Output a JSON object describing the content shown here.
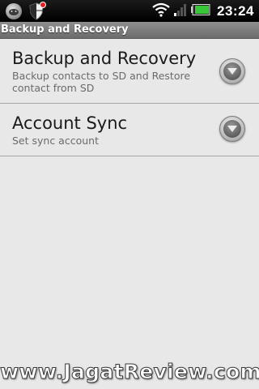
{
  "status_bar": {
    "time": "23:24",
    "icons": [
      "android-notification-icon",
      "shield-alert-icon",
      "wifi-icon",
      "signal-icon",
      "battery-icon"
    ]
  },
  "header": {
    "title": "Backup and Recovery"
  },
  "list": {
    "items": [
      {
        "title": "Backup and Recovery",
        "summary": "Backup contacts to SD and Restore contact from SD"
      },
      {
        "title": "Account Sync",
        "summary": "Set sync account"
      }
    ]
  },
  "watermark": "www.JagatReview.com",
  "colors": {
    "status_bar": "#000000",
    "title_bar": "#7d7d7d",
    "background": "#e8e8e8",
    "battery": "#37c837"
  }
}
